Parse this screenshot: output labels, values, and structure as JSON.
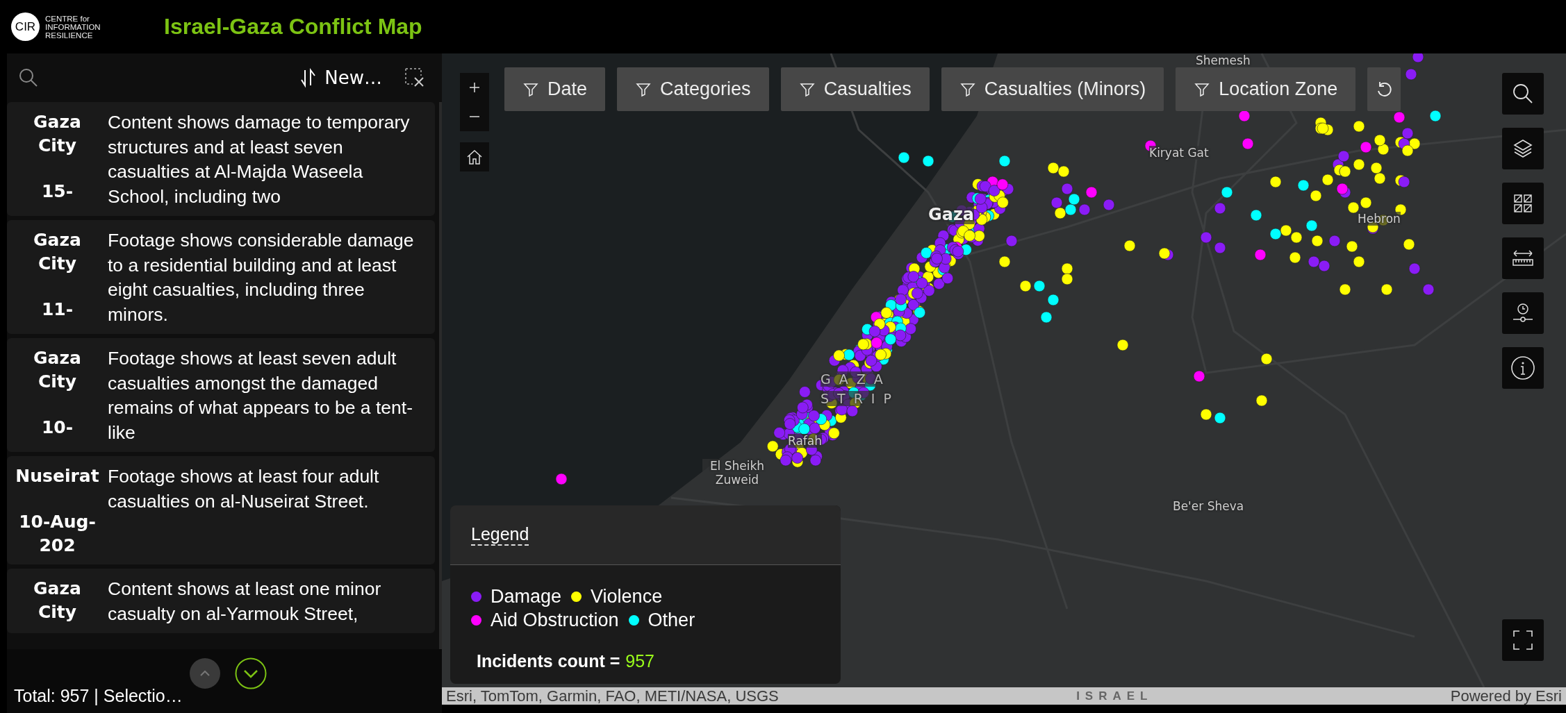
{
  "header": {
    "logo_mark": "CIR",
    "logo_text": [
      "CENTRE for",
      "INFORMATION",
      "RESILIENCE"
    ],
    "title": "Israel-Gaza Conflict Map"
  },
  "sidebar": {
    "sort_label": "New…",
    "items": [
      {
        "place": "Gaza City",
        "date": "15-",
        "description": "Content shows damage to temporary structures and at least seven casualties at Al-Majda Waseela School, including two"
      },
      {
        "place": "Gaza City",
        "date": "11-",
        "description": "Footage shows considerable damage to a residential building and at least eight casualties, including three minors."
      },
      {
        "place": "Gaza City",
        "date": "10-",
        "description": "Footage shows at least seven adult casualties amongst the damaged remains of what appears to be a tent-like"
      },
      {
        "place": "Nuseirat",
        "date": "10-Aug-202",
        "description": "Footage shows at least four adult casualties on al-Nuseirat Street."
      },
      {
        "place": "Gaza City",
        "description": "Content shows at least one minor casualty on al-Yarmouk Street,"
      }
    ],
    "summary": "Total: 957 | Selectio…"
  },
  "map": {
    "filters": [
      "Date",
      "Categories",
      "Casualties",
      "Casualties (Minors)",
      "Location Zone"
    ],
    "labels": [
      {
        "text": "Shemesh",
        "kind": "town"
      },
      {
        "text": "Kiryat Gat",
        "kind": "town"
      },
      {
        "text": "Gaza",
        "kind": "city"
      },
      {
        "text": "Hebron",
        "kind": "town"
      },
      {
        "text": "GAZA",
        "kind": "region"
      },
      {
        "text": "STRIP",
        "kind": "region"
      },
      {
        "text": "Rafah",
        "kind": "town"
      },
      {
        "text": "El Sheikh Zuweid",
        "kind": "town"
      },
      {
        "text": "Be'er Sheva",
        "kind": "town"
      }
    ],
    "legend": {
      "title": "Legend",
      "items": [
        {
          "label": "Damage",
          "color": "#8a1cf5"
        },
        {
          "label": "Violence",
          "color": "#ffff00"
        },
        {
          "label": "Aid Obstruction",
          "color": "#ff00ff"
        },
        {
          "label": "Other",
          "color": "#00ffff"
        }
      ],
      "count_label": "Incidents count =",
      "count_value": "957"
    },
    "attribution": {
      "sources": "Esri, TomTom, Garmin, FAO, METI/NASA, USGS",
      "region": "ISRAEL",
      "powered_by": "Powered by Esri"
    }
  }
}
